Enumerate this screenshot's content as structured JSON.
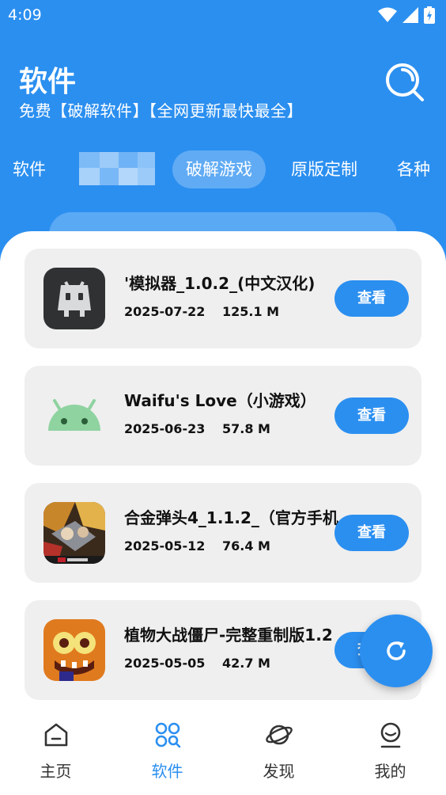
{
  "status_bar": {
    "time": "4:09"
  },
  "header": {
    "title": "软件",
    "subtitle": "免费【破解软件】【全网更新最快最全】"
  },
  "tabs": [
    {
      "label": "软件",
      "active": false
    },
    {
      "label": "破解游戏",
      "active": true
    },
    {
      "label": "原版定制",
      "active": false
    },
    {
      "label": "各种",
      "active": false
    }
  ],
  "apps": [
    {
      "name": "'模拟器_1.0.2_(中文汉化)",
      "date": "2025-07-22",
      "size": "125.1 M",
      "button": "查看",
      "icon": "cordova-robot-icon"
    },
    {
      "name": " Waifu's Love（小游戏）",
      "date": "2025-06-23",
      "size": "57.8 M",
      "button": "查看",
      "icon": "android-icon"
    },
    {
      "name": "合金弹头4_1.1.2_（官方手机",
      "date": "2025-05-12",
      "size": "76.4 M",
      "button": "查看",
      "icon": "metal-slug-icon"
    },
    {
      "name": "植物大战僵尸-完整重制版1.2",
      "date": "2025-05-05",
      "size": "42.7 M",
      "button": "查看",
      "icon": "zombie-icon"
    }
  ],
  "bottom_nav": [
    {
      "label": "主页",
      "icon": "home-icon",
      "active": false
    },
    {
      "label": "软件",
      "icon": "apps-icon",
      "active": true
    },
    {
      "label": "发现",
      "icon": "planet-icon",
      "active": false
    },
    {
      "label": "我的",
      "icon": "profile-icon",
      "active": false
    }
  ],
  "colors": {
    "primary": "#2b8ff0",
    "card_bg": "#efefef"
  }
}
